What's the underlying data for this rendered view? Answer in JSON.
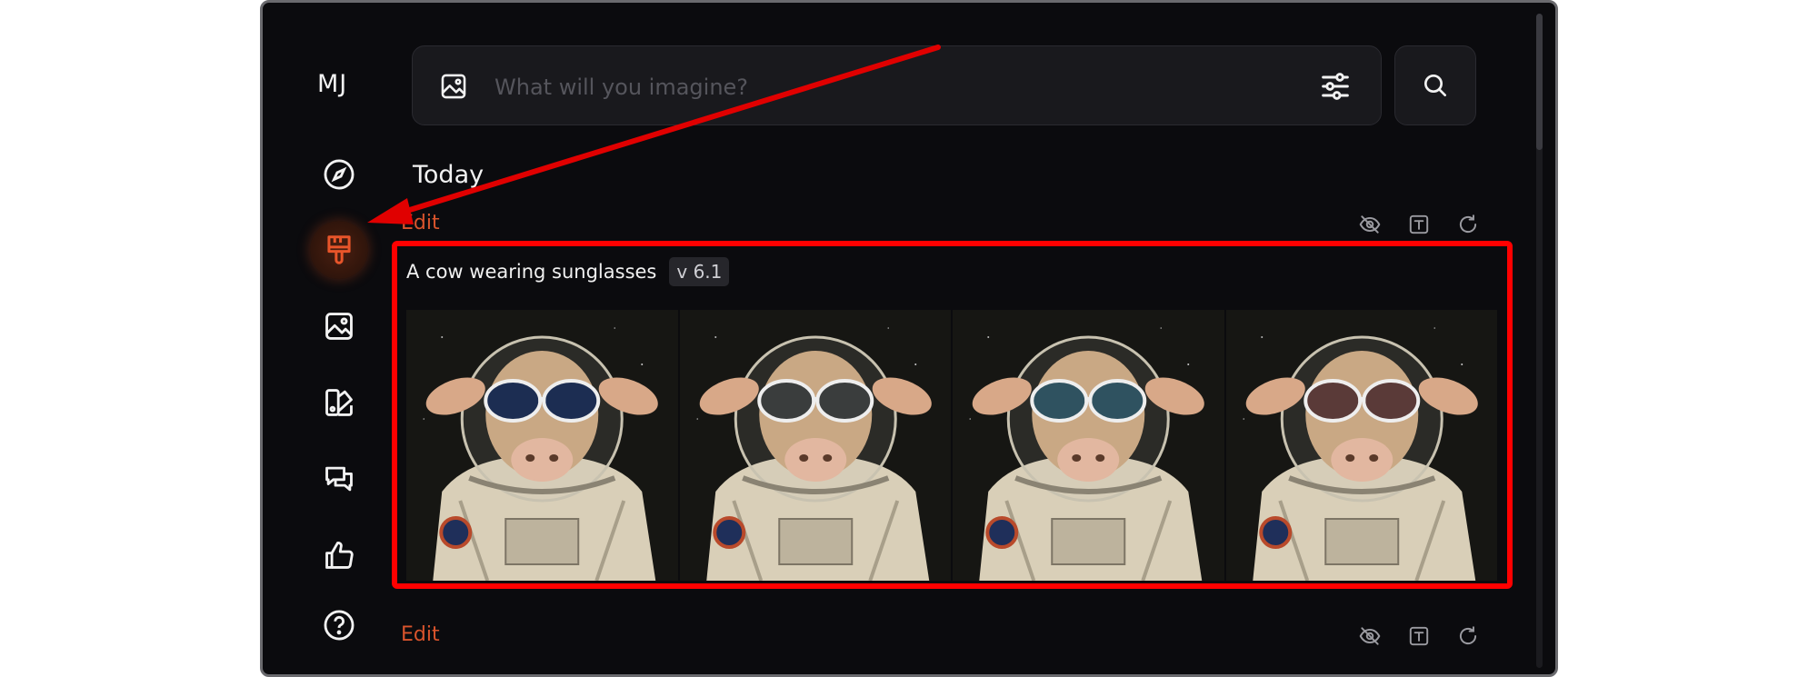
{
  "app": {
    "logo": "MJ"
  },
  "sidebar": {
    "items": [
      {
        "name": "explore",
        "icon": "compass-icon"
      },
      {
        "name": "create",
        "icon": "paintbrush-icon",
        "active": true
      },
      {
        "name": "organize",
        "icon": "image-icon"
      },
      {
        "name": "edit",
        "icon": "palette-icon"
      },
      {
        "name": "chat",
        "icon": "chat-bubbles-icon"
      },
      {
        "name": "rate",
        "icon": "thumbs-up-icon"
      },
      {
        "name": "help",
        "icon": "help-circle-icon"
      }
    ]
  },
  "search": {
    "placeholder": "What will you imagine?",
    "value": ""
  },
  "feed": {
    "section_title": "Today",
    "jobs": [
      {
        "edit_label": "Edit",
        "prompt": "A cow wearing sunglasses",
        "version": "v 6.1",
        "images": [
          {
            "lens_color": "#1c2d52"
          },
          {
            "lens_color": "#3a3d3d"
          },
          {
            "lens_color": "#2f5260"
          },
          {
            "lens_color": "#5a3a38"
          }
        ]
      },
      {
        "edit_label": "Edit"
      }
    ]
  },
  "colors": {
    "accent": "#d9542c",
    "highlight": "#ff0000",
    "background": "#0b0b0e"
  }
}
